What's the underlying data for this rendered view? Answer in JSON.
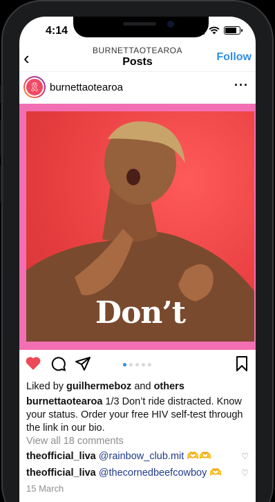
{
  "status_bar": {
    "time": "4:14"
  },
  "header": {
    "username": "BURNETTAOTEAROA",
    "title": "Posts",
    "follow_label": "Follow"
  },
  "post": {
    "author": "burnettaotearoa",
    "image_text": "Don’t",
    "carousel": {
      "count": 5,
      "active_index": 0
    },
    "liked": true,
    "likes_prefix": "Liked by ",
    "likes_user": "guilhermeboz",
    "likes_and": " and ",
    "likes_others": "others",
    "caption_user": "burnettaotearoa",
    "caption_text": " 1/3 Don’t ride distracted. Know your status. Order your free HIV self-test through the link in our bio.",
    "view_all_comments": "View all 18 comments",
    "comments": [
      {
        "user": "theofficial_liva",
        "mention": "@rainbow_club.mit",
        "emoji": "🫶🫶"
      },
      {
        "user": "theofficial_liva",
        "mention": "@thecornedbeefcowboy",
        "emoji": "🫶"
      }
    ],
    "date": "15 March"
  },
  "colors": {
    "accent": "#2f8ee8",
    "like": "#ed4956",
    "frame": "#f36fb3",
    "photo_bg": "#e63d3f"
  }
}
